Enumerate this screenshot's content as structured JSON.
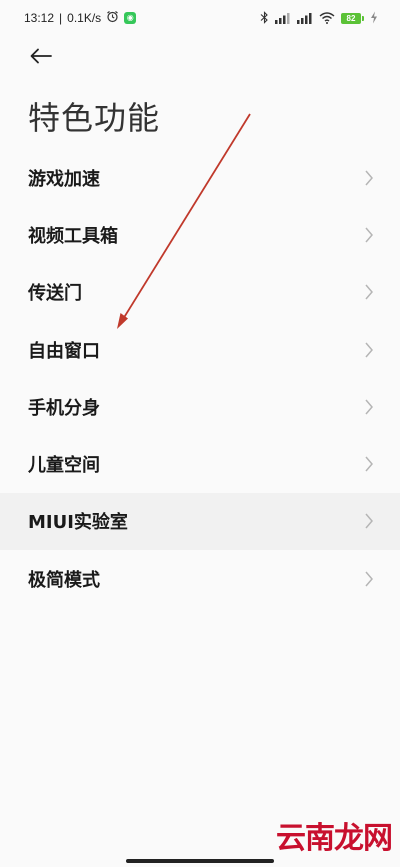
{
  "status_bar": {
    "time": "13:12",
    "network_speed": "0.1K/s",
    "battery_level": "82",
    "icons": [
      "alarm-icon",
      "bluetooth-icon",
      "signal-icon",
      "wifi-icon",
      "charging-icon"
    ]
  },
  "header": {
    "back_icon": "arrow-left-icon",
    "title": "特色功能"
  },
  "menu": {
    "items": [
      {
        "label": "游戏加速"
      },
      {
        "label": "视频工具箱"
      },
      {
        "label": "传送门"
      },
      {
        "label": "自由窗口"
      },
      {
        "label": "手机分身"
      },
      {
        "label": "儿童空间"
      },
      {
        "label": "MIUI实验室"
      },
      {
        "label": "极简模式"
      }
    ]
  },
  "watermark": {
    "text": "云南龙网"
  },
  "colors": {
    "annotation_arrow": "#c0392b",
    "watermark": "#c8102e",
    "battery": "#5bc236"
  }
}
